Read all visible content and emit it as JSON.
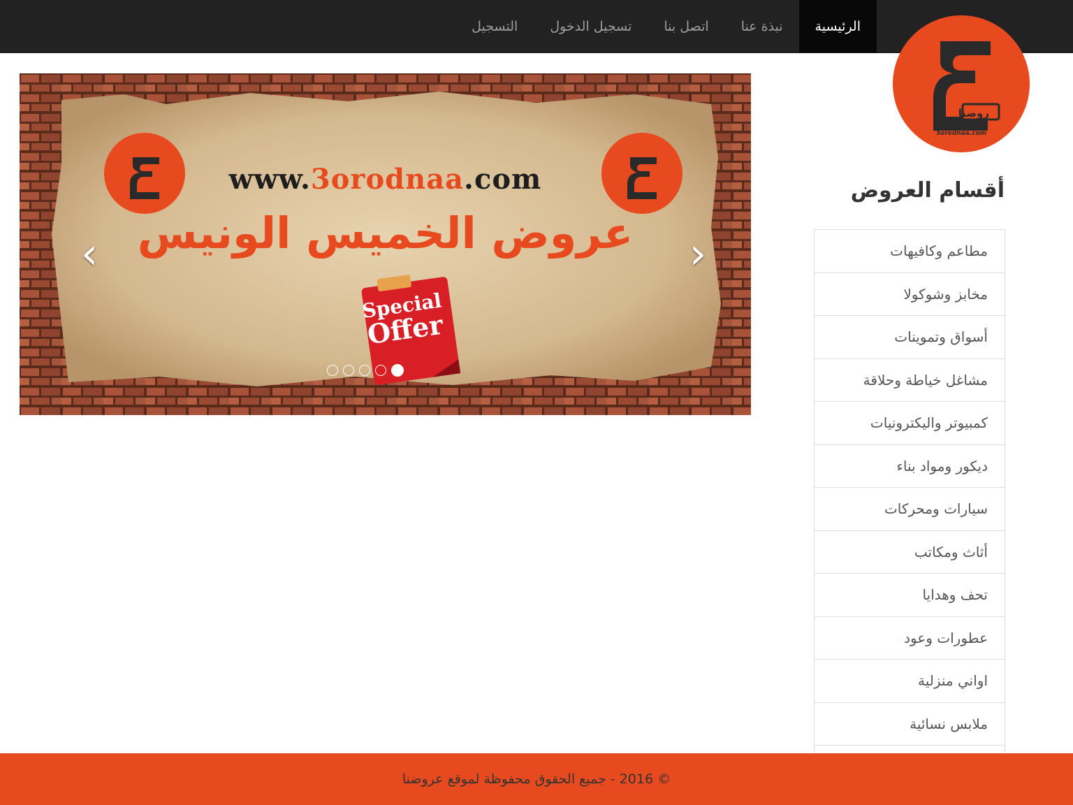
{
  "nav": {
    "items": [
      "الرئيسية",
      "نبذة عنا",
      "اتصل بنا",
      "تسجيل الدخول",
      "التسجيل"
    ],
    "active_index": 0
  },
  "logo": {
    "text": "3orodnaa.com",
    "badge": "روضنا",
    "color": "#e84a1f"
  },
  "slider": {
    "url_prefix": "www.",
    "url_accent": "3orodnaa",
    "url_suffix": ".com",
    "title": "عروض الخميس الونيس",
    "sticker_line1": "Special",
    "sticker_line2": "Offer",
    "prev_icon": "‹",
    "next_icon": "›",
    "slide_count": 5,
    "active_slide": 4
  },
  "sidebar": {
    "heading": "أقسام العروض",
    "categories": [
      "مطاعم وكافيهات",
      "مخابز وشوكولا",
      "أسواق وتموينات",
      "مشاغل خياطة وحلاقة",
      "كمبيوتر واليكترونيات",
      "ديكور ومواد بناء",
      "سيارات ومحركات",
      "أثاث ومكاتب",
      "تحف وهدايا",
      "عطورات وعود",
      "اواني منزلية",
      "ملابس نسائية",
      ""
    ]
  },
  "footer": {
    "text": "© 2016 - جميع الحقوق محفوظة لموقع عروضنا"
  },
  "colors": {
    "brand": "#e84a1f",
    "nav_bg": "#222222",
    "nav_active": "#080808"
  }
}
